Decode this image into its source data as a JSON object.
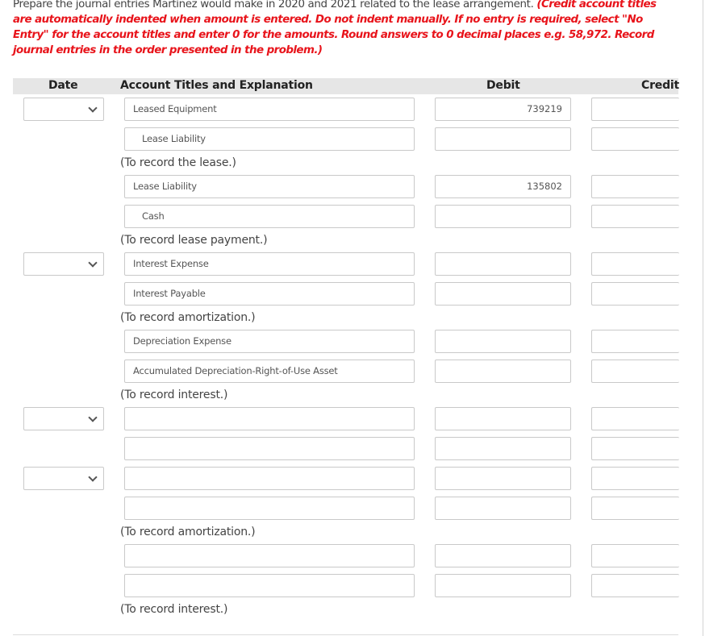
{
  "instructions": {
    "plain": "Prepare the journal entries Martinez would make in 2020 and 2021 related to the lease arrangement. ",
    "emphasis": "(Credit account titles are automatically indented when amount is entered. Do not indent manually. If no entry is required, select \"No Entry\" for the account titles and enter 0 for the amounts. Round answers to 0 decimal places e.g. 58,972. Record journal entries in the order presented in the problem.)"
  },
  "table": {
    "headers": {
      "date": "Date",
      "account": "Account Titles and Explanation",
      "debit": "Debit",
      "credit": "Credit"
    },
    "rows": [
      {
        "date": "",
        "account": "Leased Equipment",
        "indent": false,
        "debit": "739219",
        "credit": ""
      },
      {
        "account": "Lease Liability",
        "indent": true,
        "debit": "",
        "credit": ""
      },
      {
        "account": "Lease Liability",
        "indent": false,
        "debit": "135802",
        "credit": ""
      },
      {
        "account": "Cash",
        "indent": true,
        "debit": "",
        "credit": ""
      },
      {
        "date": "",
        "account": "Interest Expense",
        "indent": false,
        "debit": "",
        "credit": ""
      },
      {
        "account": "Interest Payable",
        "indent": false,
        "debit": "",
        "credit": ""
      },
      {
        "account": "Depreciation Expense",
        "indent": false,
        "debit": "",
        "credit": ""
      },
      {
        "account": "Accumulated Depreciation-Right-of-Use Asset",
        "indent": false,
        "debit": "",
        "credit": ""
      },
      {
        "date": "",
        "account": "",
        "debit": "",
        "credit": ""
      },
      {
        "account": "",
        "debit": "",
        "credit": ""
      },
      {
        "date": "",
        "account": "",
        "debit": "",
        "credit": ""
      },
      {
        "account": "",
        "debit": "",
        "credit": ""
      },
      {
        "account": "",
        "debit": "",
        "credit": ""
      },
      {
        "account": "",
        "debit": "",
        "credit": ""
      }
    ],
    "explanations": [
      "(To record the lease.)",
      "(To record lease payment.)",
      "(To record amortization.)",
      "(To record interest.)",
      "(To record amortization.)",
      "(To record interest.)"
    ]
  }
}
